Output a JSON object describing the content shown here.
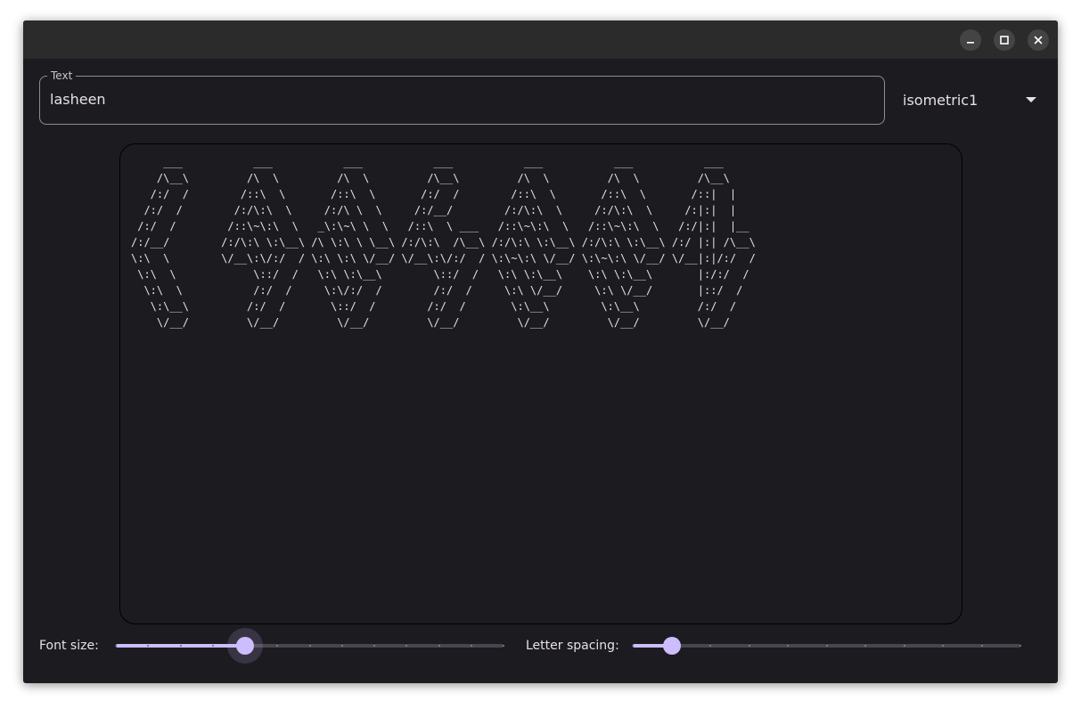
{
  "window": {
    "controls": {
      "minimize_icon": "minimize-icon",
      "maximize_icon": "maximize-icon",
      "close_icon": "close-icon"
    }
  },
  "text_input": {
    "label": "Text",
    "value": "lasheen"
  },
  "font_select": {
    "selected": "isometric1",
    "icon": "dropdown-arrow-icon"
  },
  "preview": {
    "ascii_art": "     ___           ___           ___           ___           ___           ___           ___     \n    /\\__\\         /\\  \\         /\\  \\         /\\__\\         /\\  \\         /\\  \\         /\\__\\    \n   /:/  /        /::\\  \\       /::\\  \\       /:/  /        /::\\  \\       /::\\  \\       /::|  |   \n  /:/  /        /:/\\:\\  \\     /:/\\ \\  \\     /:/__/        /:/\\:\\  \\     /:/\\:\\  \\     /:|:|  |   \n /:/  /        /::\\~\\:\\  \\   _\\:\\~\\ \\  \\   /::\\  \\ ___   /::\\~\\:\\  \\   /::\\~\\:\\  \\   /:/|:|  |__ \n/:/__/        /:/\\:\\ \\:\\__\\ /\\ \\:\\ \\ \\__\\ /:/\\:\\  /\\__\\ /:/\\:\\ \\:\\__\\ /:/\\:\\ \\:\\__\\ /:/ |:| /\\__\\\n\\:\\  \\        \\/__\\:\\/:/  / \\:\\ \\:\\ \\/__/ \\/__\\:\\/:/  / \\:\\~\\:\\ \\/__/ \\:\\~\\:\\ \\/__/ \\/__|:|/:/  /\n \\:\\  \\            \\::/  /   \\:\\ \\:\\__\\        \\::/  /   \\:\\ \\:\\__\\    \\:\\ \\:\\__\\       |:/:/  / \n  \\:\\  \\           /:/  /     \\:\\/:/  /        /:/  /     \\:\\ \\/__/     \\:\\ \\/__/       |::/  /  \n   \\:\\__\\         /:/  /       \\::/  /        /:/  /       \\:\\__\\        \\:\\__\\         /:/  /   \n    \\/__/         \\/__/         \\/__/         \\/__/         \\/__/         \\/__/         \\/__/    "
  },
  "font_size": {
    "label": "Font size:",
    "value_fraction": 0.333,
    "tick_count": 13
  },
  "letter_spacing": {
    "label": "Letter spacing:",
    "value_fraction": 0.1,
    "tick_count": 11
  },
  "colors": {
    "background": "#1c1b20",
    "accent": "#cdbdff",
    "outline": "#8f8c95",
    "text": "#e6e1e6"
  }
}
